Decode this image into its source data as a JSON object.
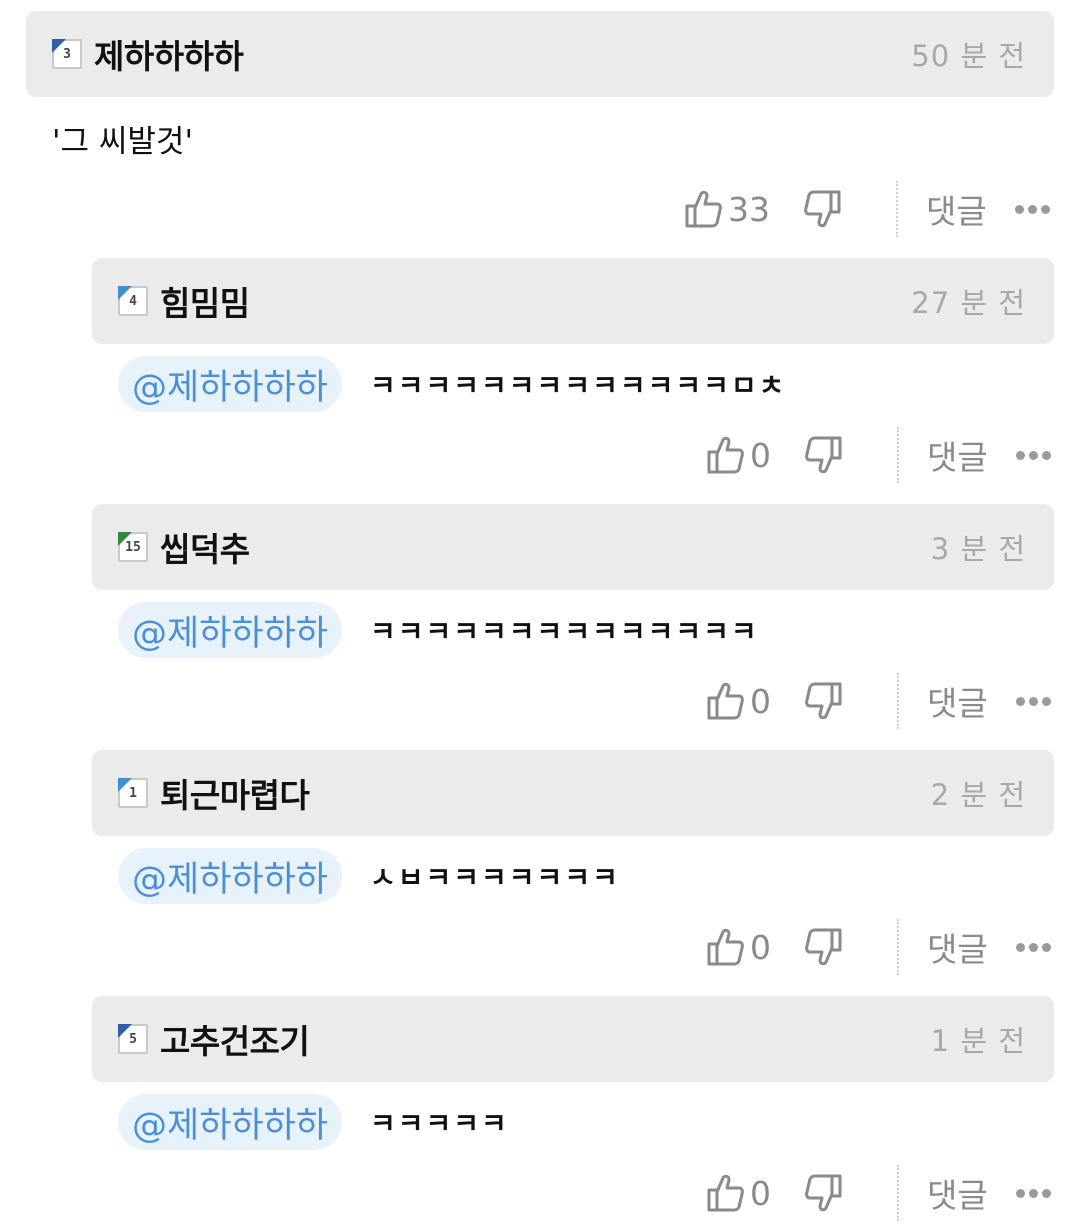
{
  "comments": [
    {
      "level": "3",
      "nickname": "제하하하하",
      "time": "50 분 전",
      "text": "'그 씨발것'",
      "likes": "33",
      "reply_label": "댓글"
    },
    {
      "level": "4",
      "nickname": "힘밈밈",
      "time": "27 분 전",
      "mention": "@제하하하하",
      "text": "ㅋㅋㅋㅋㅋㅋㅋㅋㅋㅋㅋㅋㅋㅁㅊ",
      "likes": "0",
      "reply_label": "댓글"
    },
    {
      "level": "15",
      "nickname": "씹덕추",
      "time": "3 분 전",
      "mention": "@제하하하하",
      "text": "ㅋㅋㅋㅋㅋㅋㅋㅋㅋㅋㅋㅋㅋㅋ",
      "likes": "0",
      "reply_label": "댓글"
    },
    {
      "level": "1",
      "nickname": "퇴근마렵다",
      "time": "2 분 전",
      "mention": "@제하하하하",
      "text": "ㅅㅂㅋㅋㅋㅋㅋㅋㅋ",
      "likes": "0",
      "reply_label": "댓글"
    },
    {
      "level": "5",
      "nickname": "고추건조기",
      "time": "1 분 전",
      "mention": "@제하하하하",
      "text": "ㅋㅋㅋㅋㅋ",
      "likes": "0",
      "reply_label": "댓글"
    }
  ],
  "icons": {
    "like": "thumbs-up-icon",
    "dislike": "thumbs-down-icon",
    "more": "more-dots-icon"
  },
  "colors": {
    "header_bg": "#ebebeb",
    "mention_bg": "#e8f2fb",
    "mention_text": "#4a90d9",
    "time_text": "#a8a8a8"
  }
}
